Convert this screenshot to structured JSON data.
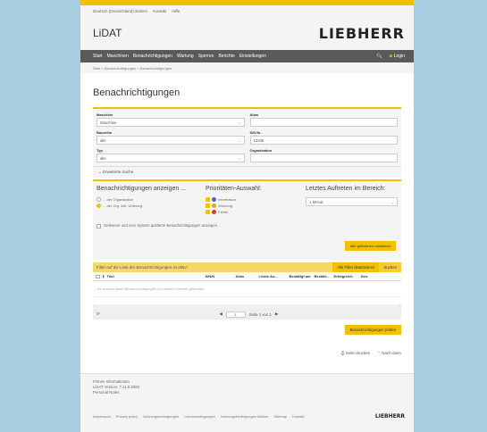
{
  "toplinks": [
    "Deutsch (Deutschland) ändern",
    "Kontakt",
    "Hilfe"
  ],
  "app": {
    "name": "LiDAT",
    "brand": "LIEBHERR"
  },
  "nav": {
    "items": [
      "Start",
      "Maschinen",
      "Benachrichtigungen",
      "Wartung",
      "Sperren",
      "Berichte",
      "Einstellungen"
    ],
    "login": "Login"
  },
  "breadcrumb": "Start > Benachrichtigungen > Benachrichtigungen",
  "page_title": "Benachrichtigungen",
  "form": {
    "maschine_label": "Maschine",
    "maschine_value": "Maschine",
    "alias_label": "Alias",
    "alias_value": "",
    "baureihe_label": "Baureihe",
    "baureihe_value": "alle",
    "sn_label": "S/N Nr.",
    "sn_value": "12345",
    "typ_label": "Typ",
    "typ_value": "alle",
    "org_label": "Organisation",
    "org_value": ""
  },
  "ext_search": "Erweiterte Suche",
  "options": {
    "show_title": "Benachrichtigungen anzeigen ...",
    "show_opts": [
      "... der Organisation",
      "... der Org. inkl. Unterorg."
    ],
    "prio_title": "Prioritäten-Auswahl:",
    "prio_opts": [
      "Information",
      "Warnung",
      "Fehler"
    ],
    "last_title": "Letztes Auftreten im Bereich:",
    "last_value": "1 Monat",
    "include_label": "Gelesene und vom System quittierte Benachrichtigungen anzeigen",
    "mark_btn": "Alle gelesenen markieren"
  },
  "filterbar": {
    "text": "Filter auf die Liste der Benachrichtigungen ist aktiv!",
    "reset": "Alle Filter deaktivieren",
    "search": "Suchen"
  },
  "table": {
    "headers": [
      "Titel",
      "S/N/N",
      "Alias",
      "Letzte Au...",
      "Bestätigt am",
      "Bestäti...",
      "Erfolgreich",
      "Ges."
    ],
    "empty": "Es wurden keine Benachrichtigungen mit diesen Kriterien gefunden."
  },
  "pager": {
    "page": "1",
    "info": "Seite 1 von 1"
  },
  "main_btn": "Benachrichtigungen prüfen",
  "actions": {
    "print": "Seite drucken",
    "top": "Nach oben"
  },
  "footer": {
    "info": [
      "Firmen Informationen",
      "LiDAT Version: 7.11.0.2008",
      "Personal Notes"
    ],
    "links": [
      "Impressum",
      "Privacy policy",
      "Nutzungsbedingungen",
      "Lizenzbedingungen",
      "Nutzungsbedingungen Marine",
      "Sitemap",
      "Kontakt"
    ],
    "brand": "LIEBHERR"
  },
  "colors": {
    "accent": "#f3c000",
    "nav": "#5a5a5a",
    "backdrop": "#a8cde0"
  }
}
